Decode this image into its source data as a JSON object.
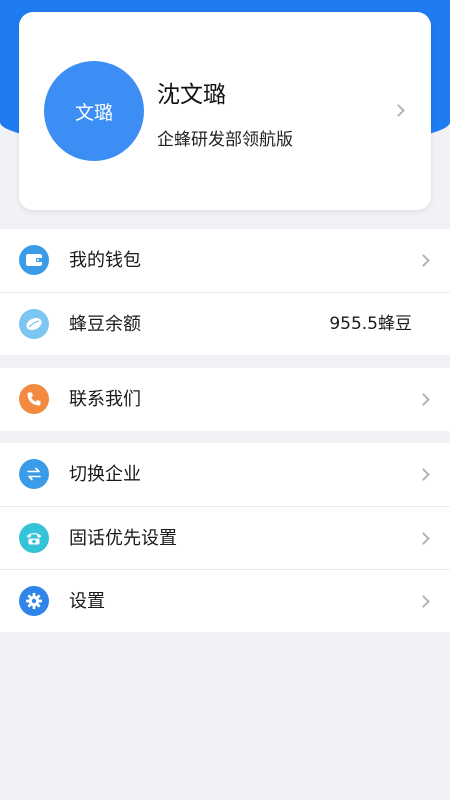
{
  "profile": {
    "avatar_text": "文璐",
    "name": "沈文璐",
    "subtitle": "企蜂研发部领航版"
  },
  "menu": {
    "wallet": {
      "label": "我的钱包",
      "icon": "wallet-icon",
      "color": "#3a9be8"
    },
    "beans": {
      "label": "蜂豆余额",
      "value": "955.5蜂豆",
      "icon": "bean-icon",
      "color": "#7cc7f2"
    },
    "contact": {
      "label": "联系我们",
      "icon": "phone-icon",
      "color": "#f28a3f"
    },
    "switch_company": {
      "label": "切换企业",
      "icon": "swap-icon",
      "color": "#3a9be8"
    },
    "landline_priority": {
      "label": "固话优先设置",
      "icon": "telephone-icon",
      "color": "#35c3d8"
    },
    "settings": {
      "label": "设置",
      "icon": "gear-icon",
      "color": "#2f86e8"
    }
  },
  "colors": {
    "header_blue": "#1f7bf0",
    "avatar_blue": "#3c8ef5",
    "page_background": "#f1f2f6"
  }
}
